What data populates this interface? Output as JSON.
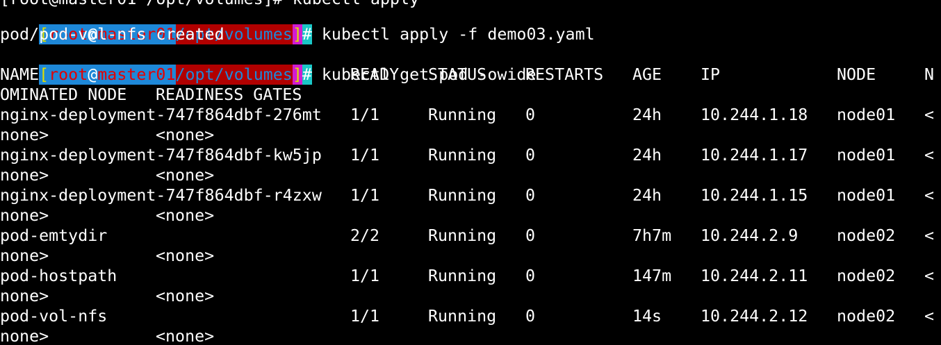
{
  "prompt": {
    "bracket_open": "[",
    "user": "root",
    "at": "@",
    "host": "master01",
    "path": "/opt/volumes",
    "bracket_close": "]",
    "hash": "#"
  },
  "history": {
    "partial_previous_line": "[root@master01 /opt/volumes]# kubectl apply",
    "command_apply": "kubectl apply -f demo03.yaml",
    "output_created": "pod/pod-vol-nfs created",
    "command_get": "kubectl get pod -owide"
  },
  "table": {
    "headers": {
      "name": "NAME",
      "ready": "READY",
      "status": "STATUS",
      "restarts": "RESTARTS",
      "age": "AGE",
      "ip": "IP",
      "node": "NODE",
      "nominated_wrap_start": "N",
      "nominated_wrap_rest": "OMINATED NODE",
      "readiness_gates": "READINESS GATES"
    },
    "rows": [
      {
        "name": "nginx-deployment-747f864dbf-276mt",
        "ready": "1/1",
        "status": "Running",
        "restarts": "0",
        "age": "24h",
        "ip": "10.244.1.18",
        "node": "node01",
        "nominated_start": "<",
        "nominated_rest": "none>",
        "readiness": "<none>"
      },
      {
        "name": "nginx-deployment-747f864dbf-kw5jp",
        "ready": "1/1",
        "status": "Running",
        "restarts": "0",
        "age": "24h",
        "ip": "10.244.1.17",
        "node": "node01",
        "nominated_start": "<",
        "nominated_rest": "none>",
        "readiness": "<none>"
      },
      {
        "name": "nginx-deployment-747f864dbf-r4zxw",
        "ready": "1/1",
        "status": "Running",
        "restarts": "0",
        "age": "24h",
        "ip": "10.244.1.15",
        "node": "node01",
        "nominated_start": "<",
        "nominated_rest": "none>",
        "readiness": "<none>"
      },
      {
        "name": "pod-emtydir",
        "ready": "2/2",
        "status": "Running",
        "restarts": "0",
        "age": "7h7m",
        "ip": "10.244.2.9",
        "node": "node02",
        "nominated_start": "<",
        "nominated_rest": "none>",
        "readiness": "<none>"
      },
      {
        "name": "pod-hostpath",
        "ready": "1/1",
        "status": "Running",
        "restarts": "0",
        "age": "147m",
        "ip": "10.244.2.11",
        "node": "node02",
        "nominated_start": "<",
        "nominated_rest": "none>",
        "readiness": "<none>"
      },
      {
        "name": "pod-vol-nfs",
        "ready": "1/1",
        "status": "Running",
        "restarts": "0",
        "age": "14s",
        "ip": "10.244.2.12",
        "node": "node02",
        "nominated_start": "<",
        "nominated_rest": "none>",
        "readiness": "<none>"
      }
    ]
  },
  "colors": {
    "background": "#000000",
    "text": "#ffffff",
    "prompt_user_bg": "#1e88d8",
    "prompt_user_fg": "#e40000",
    "prompt_path_bg": "#b10000",
    "prompt_bracket_bg": "#d21bd2",
    "prompt_hash_bg": "#1ac7c7",
    "prompt_bracket_fg": "#e0e000"
  }
}
